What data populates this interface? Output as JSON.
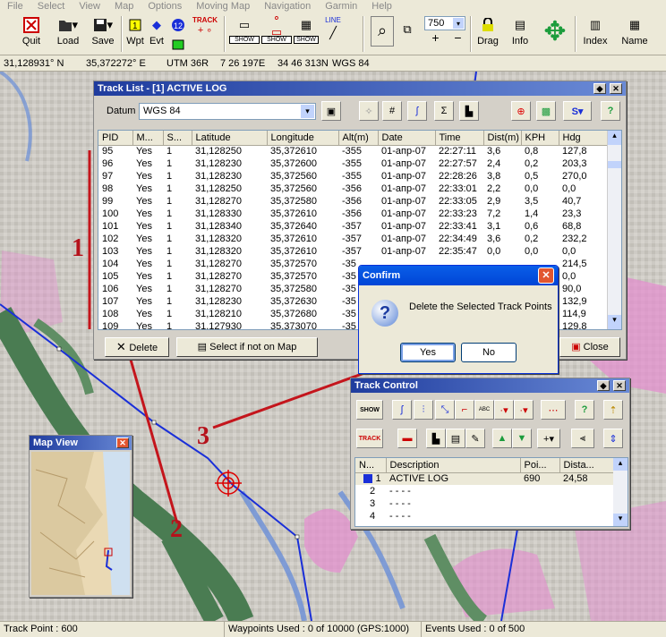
{
  "menu": [
    "File",
    "Select",
    "View",
    "Map",
    "Options",
    "Moving Map",
    "Navigation",
    "Garmin",
    "Help"
  ],
  "toolbar": {
    "quit": "Quit",
    "load": "Load",
    "save": "Save",
    "wpt": "Wpt",
    "evt": "Evt",
    "track": "TRACK",
    "show": "SHOW",
    "zoom_value": "750",
    "drag": "Drag",
    "info": "Info",
    "index": "Index",
    "name": "Name",
    "line": "LINE"
  },
  "coords": {
    "lat": "31,128931° N",
    "lon": "35,372272° E",
    "utm": "UTM  36R",
    "east": "7 26 197E",
    "north": "34 46 313N",
    "datum": "WGS 84"
  },
  "track_list": {
    "title": "Track List - [1] ACTIVE LOG",
    "datum_label": "Datum",
    "datum_value": "WGS 84",
    "columns": [
      "PID",
      "M...",
      "S...",
      "Latitude",
      "Longitude",
      "Alt(m)",
      "Date",
      "Time",
      "Dist(m)",
      "KPH",
      "Hdg"
    ],
    "rows": [
      [
        "95",
        "Yes",
        "1",
        "31,128250",
        "35,372610",
        "-355",
        "01-апр-07",
        "22:27:11",
        "3,6",
        "0,8",
        "127,8"
      ],
      [
        "96",
        "Yes",
        "1",
        "31,128230",
        "35,372600",
        "-355",
        "01-апр-07",
        "22:27:57",
        "2,4",
        "0,2",
        "203,3"
      ],
      [
        "97",
        "Yes",
        "1",
        "31,128230",
        "35,372560",
        "-355",
        "01-апр-07",
        "22:28:26",
        "3,8",
        "0,5",
        "270,0"
      ],
      [
        "98",
        "Yes",
        "1",
        "31,128250",
        "35,372560",
        "-356",
        "01-апр-07",
        "22:33:01",
        "2,2",
        "0,0",
        "0,0"
      ],
      [
        "99",
        "Yes",
        "1",
        "31,128270",
        "35,372580",
        "-356",
        "01-апр-07",
        "22:33:05",
        "2,9",
        "3,5",
        "40,7"
      ],
      [
        "100",
        "Yes",
        "1",
        "31,128330",
        "35,372610",
        "-356",
        "01-апр-07",
        "22:33:23",
        "7,2",
        "1,4",
        "23,3"
      ],
      [
        "101",
        "Yes",
        "1",
        "31,128340",
        "35,372640",
        "-357",
        "01-апр-07",
        "22:33:41",
        "3,1",
        "0,6",
        "68,8"
      ],
      [
        "102",
        "Yes",
        "1",
        "31,128320",
        "35,372610",
        "-357",
        "01-апр-07",
        "22:34:49",
        "3,6",
        "0,2",
        "232,2"
      ],
      [
        "103",
        "Yes",
        "1",
        "31,128320",
        "35,372610",
        "-357",
        "01-апр-07",
        "22:35:47",
        "0,0",
        "0,0",
        "0,0"
      ],
      [
        "104",
        "Yes",
        "1",
        "31,128270",
        "35,372570",
        "-35",
        "",
        "",
        "",
        "",
        "214,5"
      ],
      [
        "105",
        "Yes",
        "1",
        "31,128270",
        "35,372570",
        "-35",
        "",
        "",
        "",
        "",
        "0,0"
      ],
      [
        "106",
        "Yes",
        "1",
        "31,128270",
        "35,372580",
        "-35",
        "",
        "",
        "",
        "",
        "90,0"
      ],
      [
        "107",
        "Yes",
        "1",
        "31,128230",
        "35,372630",
        "-35",
        "",
        "",
        "",
        "",
        "132,9"
      ],
      [
        "108",
        "Yes",
        "1",
        "31,128210",
        "35,372680",
        "-35",
        "",
        "",
        "",
        "",
        "114,9"
      ],
      [
        "109",
        "Yes",
        "1",
        "31,127930",
        "35,373070",
        "-35",
        "",
        "",
        "",
        "",
        "129,8"
      ]
    ],
    "delete_label": "Delete",
    "select_label": "Select if not on Map",
    "close_label": "Close"
  },
  "confirm": {
    "title": "Confirm",
    "message": "Delete the Selected Track Points",
    "yes": "Yes",
    "no": "No"
  },
  "track_control": {
    "title": "Track Control",
    "columns": [
      "N...",
      "Description",
      "Poi...",
      "Dista..."
    ],
    "rows": [
      [
        "1",
        "ACTIVE LOG",
        "690",
        "24,58"
      ],
      [
        "2",
        "- - - -",
        "",
        ""
      ],
      [
        "3",
        "- - - -",
        "",
        ""
      ],
      [
        "4",
        "- - - -",
        "",
        ""
      ]
    ],
    "abc": "ABC",
    "track_btn": "TRACK",
    "show_btn": "SHOW"
  },
  "map_view": {
    "title": "Map View"
  },
  "annotations": [
    "1",
    "2",
    "3"
  ],
  "status": {
    "track_point": "Track Point : 600",
    "waypoints": "Waypoints Used : 0 of 10000  (GPS:1000)",
    "events": "Events Used : 0 of 500"
  },
  "colors": {
    "title_bar": "#1f3c9e",
    "arrow_red": "#c4151c",
    "track_blue": "#1a2fd8"
  }
}
